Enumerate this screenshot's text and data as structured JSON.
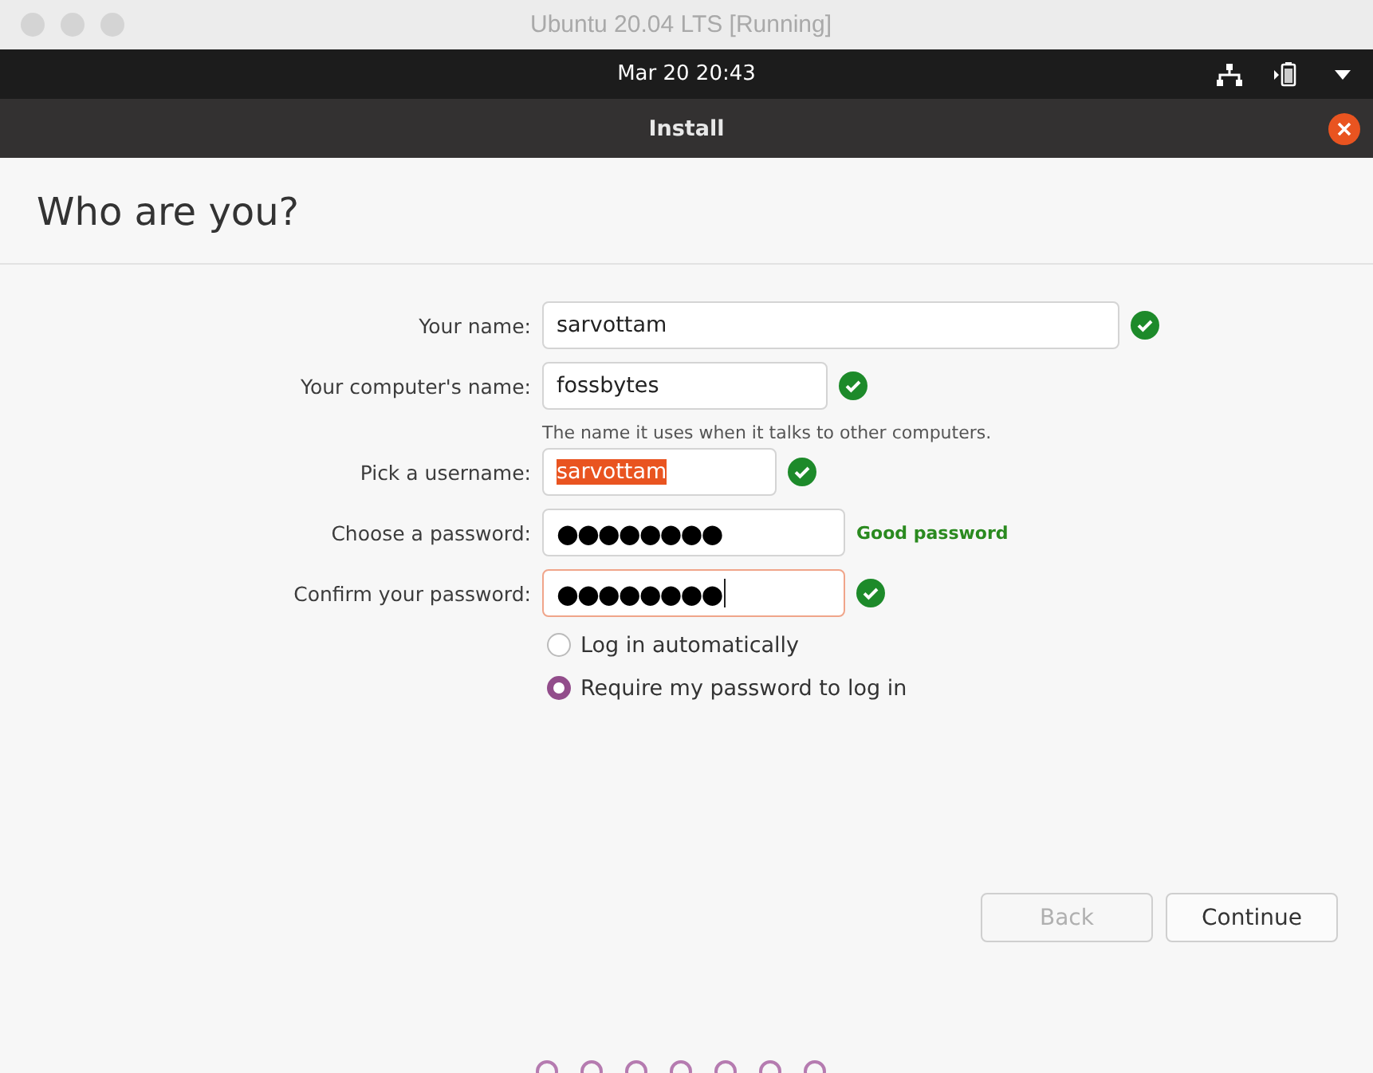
{
  "window": {
    "title": "Ubuntu 20.04 LTS [Running]"
  },
  "top_bar": {
    "clock": "Mar 20  20:43"
  },
  "dialog": {
    "title": "Install",
    "heading": "Who are you?"
  },
  "fields": [
    {
      "label": "Your name:",
      "value": "sarvottam",
      "valid": true,
      "focused": false,
      "text_selected": false
    },
    {
      "label": "Your computer's name:",
      "value": "fossbytes",
      "valid": true,
      "focused": false,
      "text_selected": false,
      "hint": "The name it uses when it talks to other computers."
    },
    {
      "label": "Pick a username:",
      "value": "sarvottam",
      "valid": true,
      "focused": false,
      "text_selected": true
    },
    {
      "label": "Choose a password:",
      "value": "●●●●●●●●",
      "valid": false,
      "focused": false,
      "text_selected": false,
      "strength": "Good password"
    },
    {
      "label": "Confirm your password:",
      "value": "●●●●●●●●",
      "valid": true,
      "focused": true,
      "text_selected": false
    }
  ],
  "login_options": [
    {
      "label": "Log in automatically",
      "selected": false
    },
    {
      "label": "Require my password to log in",
      "selected": true
    }
  ],
  "buttons": [
    {
      "label": "Back",
      "disabled": true
    },
    {
      "label": "Continue",
      "disabled": false
    }
  ],
  "progress_dots": [
    {
      "selected": false
    },
    {
      "selected": false
    },
    {
      "selected": false
    },
    {
      "selected": false
    },
    {
      "selected": false
    },
    {
      "selected": false
    },
    {
      "selected": false
    }
  ]
}
